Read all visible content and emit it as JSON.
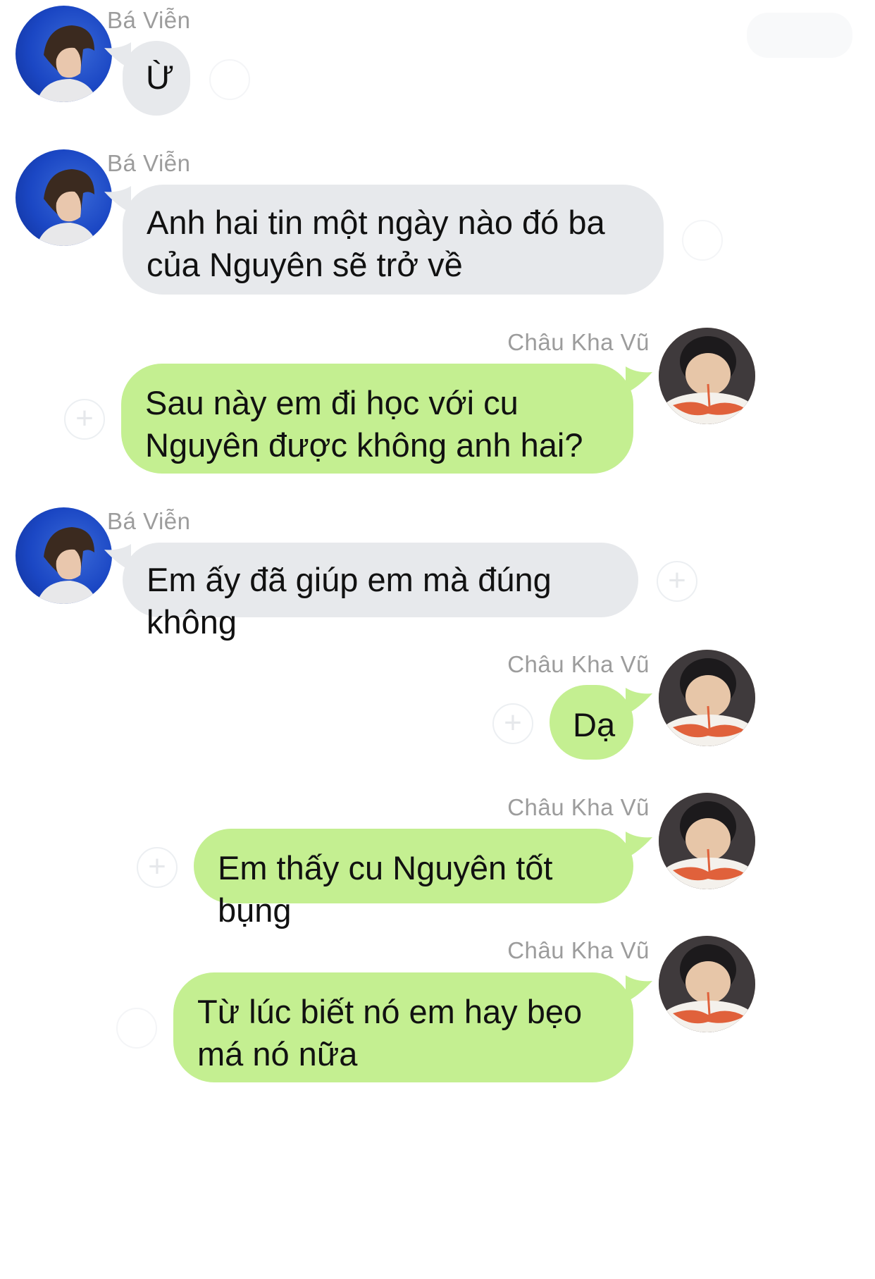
{
  "chat": {
    "messages": [
      {
        "sender": "Bá Viễn",
        "text": "Ừ",
        "side": "received"
      },
      {
        "sender": "Bá Viễn",
        "text": "Anh hai tin một ngày nào đó ba của Nguyên sẽ trở về",
        "side": "received"
      },
      {
        "sender": "Châu Kha Vũ",
        "text": "Sau này em đi học với cu Nguyên được không anh hai?",
        "side": "sent"
      },
      {
        "sender": "Bá Viễn",
        "text": "Em ấy đã giúp em mà đúng không",
        "side": "received"
      },
      {
        "sender": "Châu Kha Vũ",
        "text": "Dạ",
        "side": "sent"
      },
      {
        "sender": "Châu Kha Vũ",
        "text": "Em thấy cu Nguyên tốt bụng",
        "side": "sent"
      },
      {
        "sender": "Châu Kha Vũ",
        "text": "Từ lúc biết nó em hay bẹo má nó nữa",
        "side": "sent"
      }
    ]
  },
  "icons": {
    "plus": "+",
    "add_reaction": "add-reaction-icon",
    "avatar_received": "avatar-blue-portrait",
    "avatar_sent": "avatar-eating-noodles"
  },
  "colors": {
    "received_bubble": "#e7e9ec",
    "sent_bubble": "#c4ef91",
    "sender_name": "#9c9c9c"
  }
}
